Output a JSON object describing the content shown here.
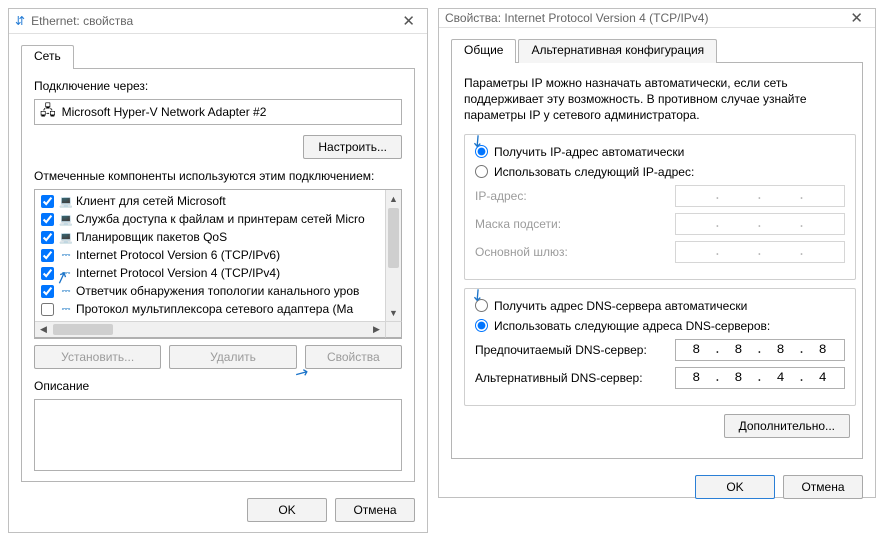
{
  "left": {
    "title": "Ethernet: свойства",
    "tab": "Сеть",
    "connectVia": "Подключение через:",
    "adapter": "Microsoft Hyper-V Network Adapter #2",
    "configureBtn": "Настроить...",
    "componentsLabel": "Отмеченные компоненты используются этим подключением:",
    "items": [
      {
        "checked": true,
        "icon": "💻",
        "label": "Клиент для сетей Microsoft"
      },
      {
        "checked": true,
        "icon": "💻",
        "label": "Служба доступа к файлам и принтерам сетей Micro"
      },
      {
        "checked": true,
        "icon": "💻",
        "label": "Планировщик пакетов QoS"
      },
      {
        "checked": true,
        "icon": "⎓",
        "net": true,
        "label": "Internet Protocol Version 6 (TCP/IPv6)"
      },
      {
        "checked": true,
        "icon": "⎓",
        "net": true,
        "label": "Internet Protocol Version 4 (TCP/IPv4)"
      },
      {
        "checked": true,
        "icon": "⎓",
        "net": true,
        "label": "Ответчик обнаружения топологии канального уров"
      },
      {
        "checked": false,
        "icon": "⎓",
        "net": true,
        "label": "Протокол мультиплексора сетевого адаптера (Ma"
      }
    ],
    "installBtn": "Установить...",
    "removeBtn": "Удалить",
    "propsBtn": "Свойства",
    "descLabel": "Описание",
    "ok": "OK",
    "cancel": "Отмена"
  },
  "right": {
    "title": "Свойства: Internet Protocol Version 4 (TCP/IPv4)",
    "tabGeneral": "Общие",
    "tabAlt": "Альтернативная конфигурация",
    "note": "Параметры IP можно назначать автоматически, если сеть поддерживает эту возможность. В противном случае узнайте параметры IP у сетевого администратора.",
    "radioAutoIP": "Получить IP-адрес автоматически",
    "radioManualIP": "Использовать следующий IP-адрес:",
    "ipAddress": "IP-адрес:",
    "subnet": "Маска подсети:",
    "gateway": "Основной шлюз:",
    "radioAutoDNS": "Получить адрес DNS-сервера автоматически",
    "radioManualDNS": "Использовать следующие адреса DNS-серверов:",
    "prefDns": "Предпочитаемый DNS-сервер:",
    "altDns": "Альтернативный DNS-сервер:",
    "dns1": [
      "8",
      "8",
      "8",
      "8"
    ],
    "dns2": [
      "8",
      "8",
      "4",
      "4"
    ],
    "advanced": "Дополнительно...",
    "ok": "OK",
    "cancel": "Отмена"
  }
}
